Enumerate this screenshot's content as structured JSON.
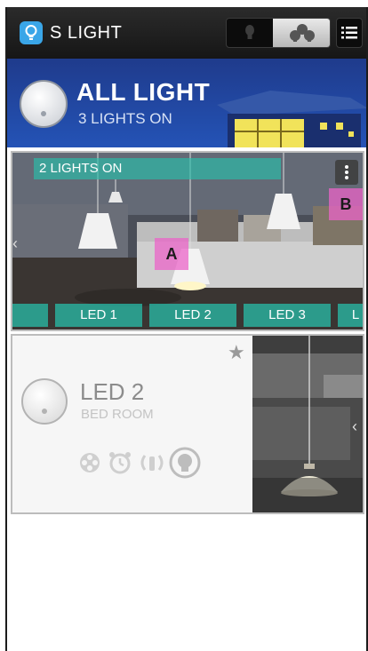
{
  "app": {
    "title": "S LIGHT",
    "icon": "lightbulb-icon"
  },
  "toolbar": {
    "segments": [
      {
        "icon": "bulb-icon",
        "selected": false
      },
      {
        "icon": "group-icon",
        "selected": true
      }
    ],
    "menu_icon": "list-menu-icon"
  },
  "all_light": {
    "title": "ALL LIGHT",
    "status": "3 LIGHTS ON"
  },
  "room_card": {
    "status": "2 LIGHTS ON",
    "markers": {
      "a": "A",
      "b": "B"
    },
    "leds": [
      "LED 1",
      "LED 2",
      "LED 3",
      "L"
    ],
    "nav_left": "‹"
  },
  "led_card": {
    "name": "LED 2",
    "room": "BED ROOM",
    "nav_right": "‹",
    "action_icons": [
      "film-reel-icon",
      "alarm-clock-icon",
      "music-sync-icon",
      "light-toggle-icon"
    ]
  },
  "colors": {
    "topbar": "#1e1e1e",
    "banner": "#2453b6",
    "accent_teal": "#28beaa",
    "marker_pink": "#eb64c8"
  }
}
